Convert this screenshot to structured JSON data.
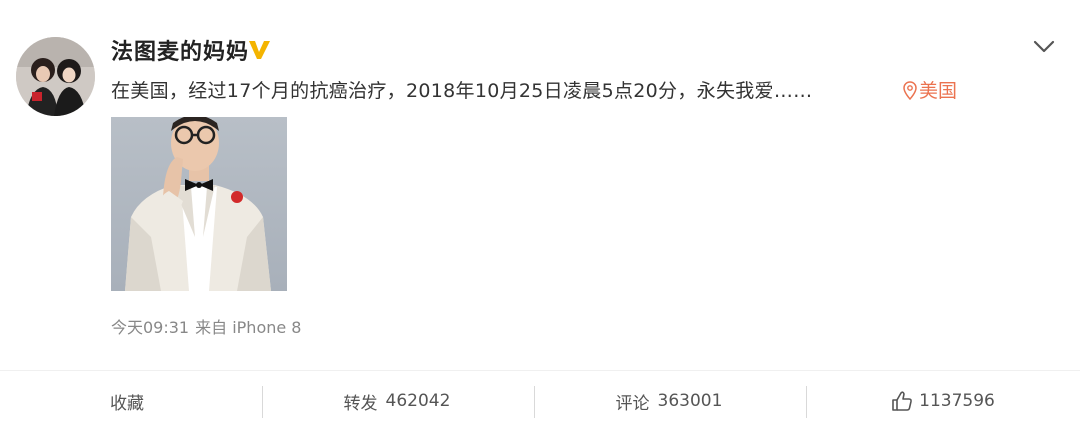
{
  "post": {
    "username": "法图麦的妈妈",
    "text": "在美国，经过17个月的抗癌治疗，2018年10月25日凌晨5点20分，永失我爱……",
    "location": "美国",
    "time": "今天09:31",
    "source": "来自 iPhone 8"
  },
  "actions": {
    "favorite_label": "收藏",
    "repost_label": "转发",
    "repost_count": "462042",
    "comment_label": "评论",
    "comment_count": "363001",
    "like_count": "1137596"
  },
  "colors": {
    "location": "#eb7350",
    "verified": "#f4b400"
  },
  "icons": {
    "verified": "verified-v-icon",
    "menu": "chevron-down-icon",
    "location": "location-pin-icon",
    "like": "thumbs-up-icon"
  }
}
